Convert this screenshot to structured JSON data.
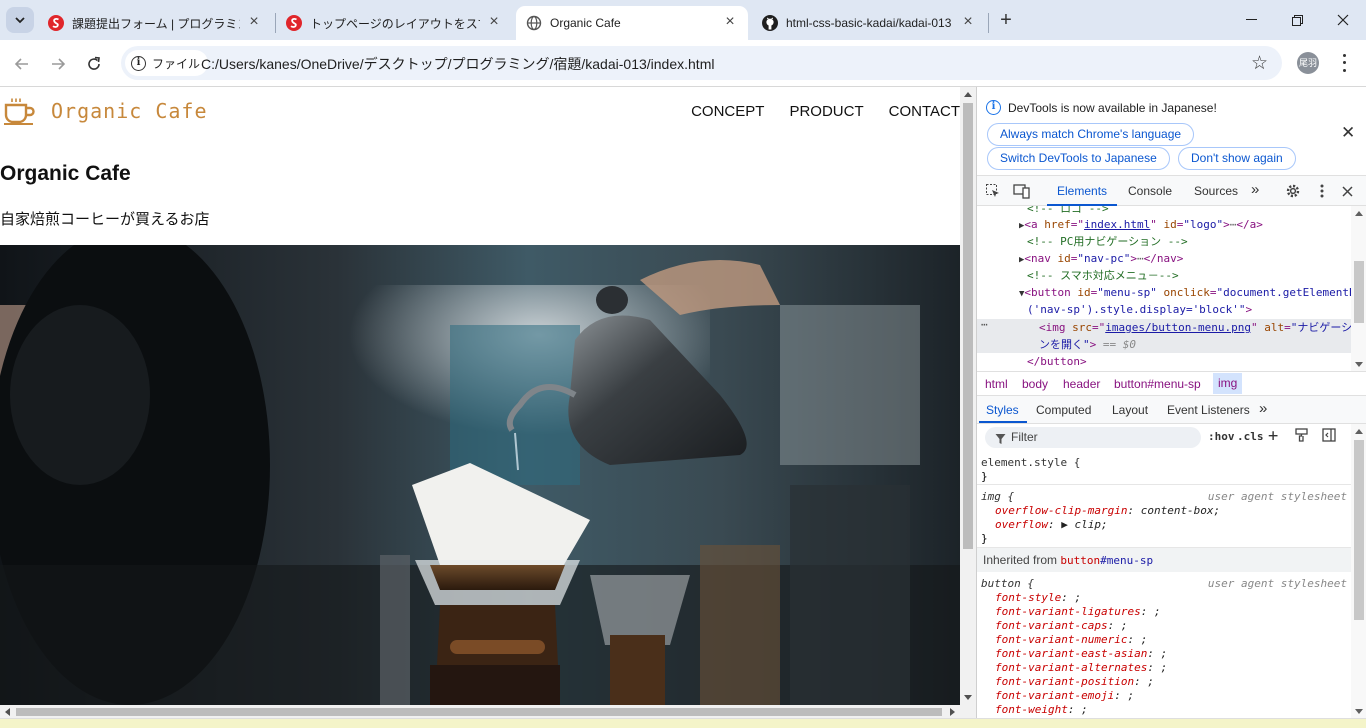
{
  "browser": {
    "tabs": [
      {
        "title": "課題提出フォーム | プログラミング学",
        "favicon": "red-s-logo-icon",
        "active": false
      },
      {
        "title": "トップページのレイアウトをスマートフォ",
        "favicon": "red-s-logo-icon",
        "active": false
      },
      {
        "title": "Organic Cafe",
        "favicon": "globe-icon",
        "active": true
      },
      {
        "title": "html-css-basic-kadai/kadai-013",
        "favicon": "github-icon",
        "active": false
      }
    ],
    "address": {
      "chip_label": "ファイル",
      "url": "C:/Users/kanes/OneDrive/デスクトップ/プログラミング/宿題/kadai-013/index.html"
    },
    "profile_label": "尾羽"
  },
  "page": {
    "logo_text": "Organic Cafe",
    "nav": [
      "CONCEPT",
      "PRODUCT",
      "CONTACT"
    ],
    "heading": "Organic Cafe",
    "tagline": "自家焙煎コーヒーが買えるお店"
  },
  "devtools": {
    "banner": {
      "message": "DevTools is now available in Japanese!",
      "buttons": [
        "Always match Chrome's language",
        "Switch DevTools to Japanese",
        "Don't show again"
      ]
    },
    "tabs": [
      "Elements",
      "Console",
      "Sources"
    ],
    "elements": {
      "comment_logo": "<!-- ロゴ -->",
      "a_tag": "a",
      "a_href_attr": "href",
      "a_href_val": "index.html",
      "a_id_attr": "id",
      "a_id_val": "\"logo\"",
      "a_close": "</a>",
      "comment_nav": "<!-- PC用ナビゲーション -->",
      "nav_tag": "nav",
      "nav_id_val": "\"nav-pc\"",
      "nav_close": "</nav>",
      "comment_menu": "<!-- スマホ対応メニュ－-->",
      "button_tag": "button",
      "button_id_val": "\"menu-sp\"",
      "button_onclick_attr": "onclick",
      "button_onclick_val_1": "\"document.getElementById",
      "button_onclick_val_2": "('nav-sp').style.display='block'\"",
      "img_tag": "img",
      "img_src_attr": "src",
      "img_src_val": "images/button-menu.png",
      "img_alt_attr": "alt",
      "img_alt_val_1": "\"ナビゲーショ",
      "img_alt_val_2": "ンを開く\"",
      "eq_marker": "== $0",
      "button_close": "</button>"
    },
    "breadcrumbs": [
      "html",
      "body",
      "header",
      "button#menu-sp",
      "img"
    ],
    "styles_tabs": [
      "Styles",
      "Computed",
      "Layout",
      "Event Listeners"
    ],
    "filter_placeholder": "Filter",
    "hov_label": ":hov",
    "cls_label": ".cls",
    "rules": {
      "element_style": "element.style {",
      "close_brace": "}",
      "img_selector": "img {",
      "ua_label": "user agent stylesheet",
      "img_props": [
        {
          "name": "overflow-clip-margin",
          "value": "content-box;"
        },
        {
          "name": "overflow",
          "value": "▶ clip;"
        }
      ],
      "inherited_label": "Inherited from",
      "inherited_tag": "button",
      "inherited_id": "#menu-sp",
      "button_selector": "button {",
      "button_props": [
        "font-style",
        "font-variant-ligatures",
        "font-variant-caps",
        "font-variant-numeric",
        "font-variant-east-asian",
        "font-variant-alternates",
        "font-variant-position",
        "font-variant-emoji",
        "font-weight"
      ]
    }
  }
}
